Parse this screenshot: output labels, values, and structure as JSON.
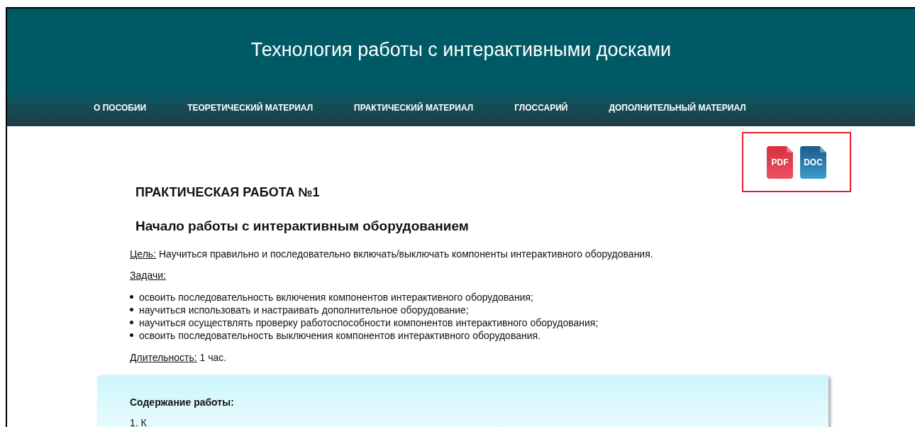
{
  "header": {
    "title": "Технология работы с интерактивными досками"
  },
  "nav": [
    "О ПОСОБИИ",
    "ТЕОРЕТИЧЕСКИЙ МАТЕРИАЛ",
    "ПРАКТИЧЕСКИЙ МАТЕРИАЛ",
    "ГЛОССАРИЙ",
    "ДОПОЛНИТЕЛЬНЫЙ МАТЕРИАЛ"
  ],
  "downloads": [
    {
      "kind": "pdf",
      "label": "PDF"
    },
    {
      "kind": "doc",
      "label": "DOC"
    }
  ],
  "heading": "ПРАКТИЧЕСКАЯ РАБОТА №1",
  "subheading": "Начало работы с интерактивным оборудованием",
  "goal": {
    "label": "Цель:",
    "text": "Научиться правильно и последовательно включать/выключать компоненты интерактивного оборудования."
  },
  "tasks_label": "Задачи:",
  "tasks": [
    "освоить последовательность включения компонентов интерактивного оборудования;",
    "научиться использовать и настраивать дополнительное оборудование;",
    "научиться осуществлять проверку работоспособности компонентов интерактивного оборудования;",
    "освоить последовательность выключения компонентов интерактивного оборудования."
  ],
  "duration": {
    "label": "Длительность:",
    "text": "1 час."
  },
  "content_box": {
    "title": "Содержание работы:",
    "first_item": "1. К"
  }
}
